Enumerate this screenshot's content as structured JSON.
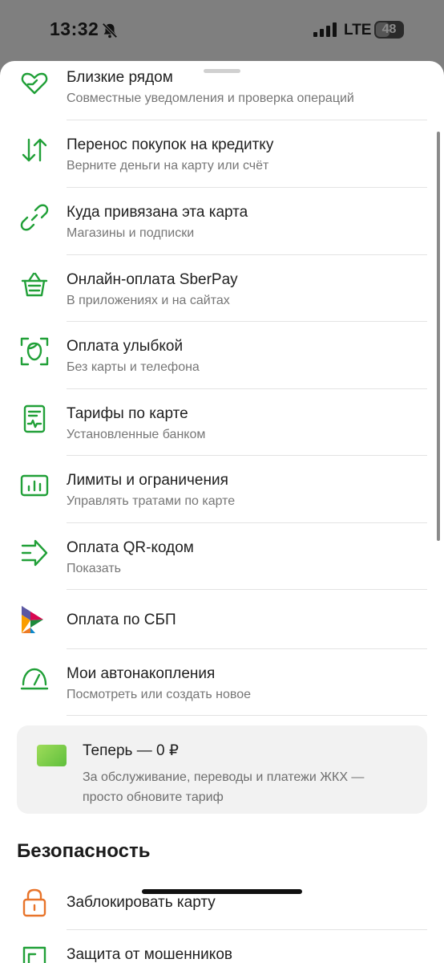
{
  "status": {
    "time": "13:32",
    "network": "LTE",
    "battery": "48"
  },
  "colors": {
    "accent": "#21a038",
    "lock": "#e8742a"
  },
  "menu": [
    {
      "icon": "heart-hands-icon",
      "title": "Близкие рядом",
      "subtitle": "Совместные уведомления и проверка операций"
    },
    {
      "icon": "transfer-arrows-icon",
      "title": "Перенос покупок на кредитку",
      "subtitle": "Верните деньги на карту или счёт"
    },
    {
      "icon": "link-icon",
      "title": "Куда привязана эта карта",
      "subtitle": "Магазины и подписки"
    },
    {
      "icon": "basket-icon",
      "title": "Онлайн-оплата SberPay",
      "subtitle": "В приложениях и на сайтах"
    },
    {
      "icon": "face-scan-icon",
      "title": "Оплата улыбкой",
      "subtitle": "Без карты и телефона"
    },
    {
      "icon": "tariff-document-icon",
      "title": "Тарифы по карте",
      "subtitle": "Установленные банком"
    },
    {
      "icon": "limits-chart-icon",
      "title": "Лимиты и ограничения",
      "subtitle": "Управлять тратами по карте"
    },
    {
      "icon": "qr-arrow-icon",
      "title": "Оплата QR-кодом",
      "subtitle": "Показать"
    },
    {
      "icon": "sbp-logo-icon",
      "title": "Оплата по СБП",
      "subtitle": ""
    },
    {
      "icon": "auto-savings-icon",
      "title": "Мои автонакопления",
      "subtitle": "Посмотреть или создать новое"
    }
  ],
  "promo": {
    "title": "Теперь — 0 ₽",
    "subtitle": "За обслуживание, переводы и платежи ЖКХ — просто обновите тариф"
  },
  "security": {
    "heading": "Безопасность",
    "items": [
      {
        "icon": "lock-icon",
        "title": "Заблокировать карту"
      },
      {
        "icon": "shield-icon",
        "title": "Защита от мошенников"
      }
    ]
  }
}
